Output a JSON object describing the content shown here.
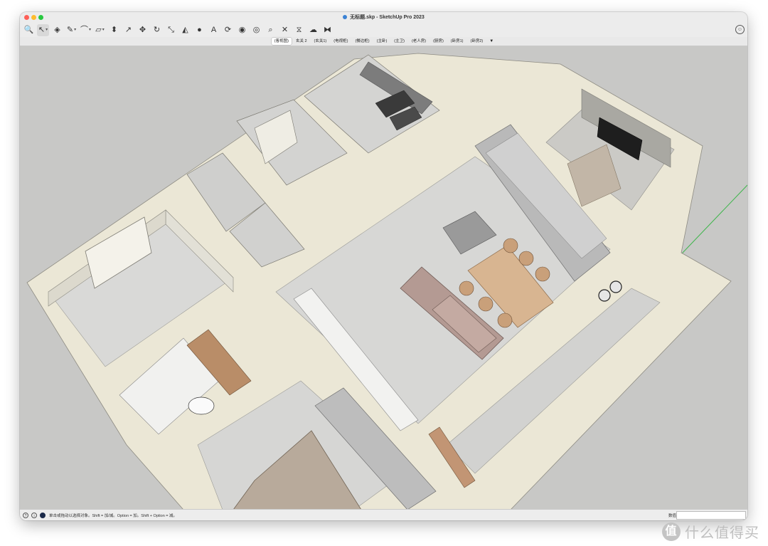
{
  "window": {
    "title": "无标题.skp - SketchUp Pro 2023"
  },
  "toolbar": {
    "tools": [
      {
        "name": "search-tool-icon",
        "glyph": "🔍"
      },
      {
        "name": "select-tool-icon",
        "glyph": "↖"
      },
      {
        "name": "eraser-tool-icon",
        "glyph": "◈"
      },
      {
        "name": "pencil-tool-icon",
        "glyph": "✎"
      },
      {
        "name": "arc-tool-icon",
        "glyph": "⌒"
      },
      {
        "name": "rectangle-tool-icon",
        "glyph": "▱"
      },
      {
        "name": "push-pull-tool-icon",
        "glyph": "⬍"
      },
      {
        "name": "follow-me-tool-icon",
        "glyph": "↗"
      },
      {
        "name": "move-tool-icon",
        "glyph": "✥"
      },
      {
        "name": "rotate-tool-icon",
        "glyph": "↻"
      },
      {
        "name": "scale-tool-icon",
        "glyph": "⤡"
      },
      {
        "name": "tape-measure-tool-icon",
        "glyph": "◭"
      },
      {
        "name": "paint-bucket-tool-icon",
        "glyph": "●"
      },
      {
        "name": "text-tool-icon",
        "glyph": "A"
      },
      {
        "name": "orbit-tool-icon",
        "glyph": "⟳"
      },
      {
        "name": "walk-tool-icon",
        "glyph": "◉"
      },
      {
        "name": "look-around-tool-icon",
        "glyph": "◎"
      },
      {
        "name": "zoom-tool-icon",
        "glyph": "⌕"
      },
      {
        "name": "zoom-extents-tool-icon",
        "glyph": "✕"
      },
      {
        "name": "section-plane-tool-icon",
        "glyph": "⧖"
      },
      {
        "name": "warehouse-tool-icon",
        "glyph": "☁"
      },
      {
        "name": "extension-tool-icon",
        "glyph": "⧓"
      }
    ],
    "account_icon": "account-icon"
  },
  "scenes": [
    "(客视图)",
    "玄关 2",
    "(玄关1)",
    "(电视柜)",
    "(餐边柜)",
    "(主卧)",
    "(主卫)",
    "(老人房)",
    "(厨房)",
    "(卧房1)",
    "(卧房2)"
  ],
  "scenes_more": "▼",
  "status": {
    "hint": "单击或拖动以选择对象。Shift = 加/减。Option = 加。Shift + Option = 减。",
    "measure_label": "数值"
  },
  "watermark": {
    "badge": "值",
    "text": "什么值得买"
  },
  "colors": {
    "viewport_bg": "#c8c8c6",
    "wall_top": "#eeeadb",
    "floor": "#d8d8d7",
    "wall_face": "#e3e1d8"
  }
}
